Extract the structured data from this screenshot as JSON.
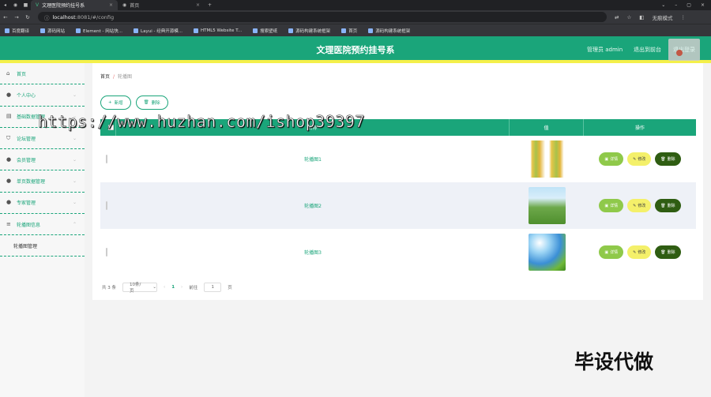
{
  "browser": {
    "tabs": [
      {
        "title": "文理医院预约挂号系",
        "active": true
      },
      {
        "title": "首页",
        "active": false
      }
    ],
    "url_host": "localhost",
    "url_rest": ":8081/#/config",
    "incognito_label": "无痕模式",
    "bookmarks": [
      "百度翻译",
      "源码网站",
      "Element - 网站快...",
      "Layui - 经典开源模...",
      "HTML5 Website T...",
      "搜索壁纸",
      "源码构建系统框架",
      "首页",
      "源码构建系统框架"
    ]
  },
  "header": {
    "title": "文理医院预约挂号系",
    "user": "管理员 admin",
    "exit_label": "退出到前台",
    "logout_label": "退出登录"
  },
  "sidebar": {
    "items": [
      {
        "label": "首页",
        "icon": "home-icon"
      },
      {
        "label": "个人中心",
        "icon": "user-icon"
      },
      {
        "label": "基础数据管理",
        "icon": "doc-icon"
      },
      {
        "label": "论坛管理",
        "icon": "shield-icon"
      },
      {
        "label": "会员管理",
        "icon": "user-icon"
      },
      {
        "label": "单页数据管理",
        "icon": "user-icon"
      },
      {
        "label": "专家管理",
        "icon": "user-icon"
      },
      {
        "label": "轮播图信息",
        "icon": "list-icon"
      }
    ],
    "submenu": "轮播图管理"
  },
  "breadcrumb": {
    "home": "首页",
    "sep": "/",
    "current": "轮播图"
  },
  "toolbar": {
    "add": "新增",
    "delete": "删除"
  },
  "table": {
    "columns": [
      "名称",
      "值",
      "操作"
    ],
    "rows": [
      {
        "name": "轮播图1",
        "image": "corn"
      },
      {
        "name": "轮播图2",
        "image": "field"
      },
      {
        "name": "轮播图3",
        "image": "sky"
      }
    ],
    "ops": {
      "detail": "详情",
      "edit": "修改",
      "delete": "删除"
    }
  },
  "pager": {
    "total": "共 3 条",
    "size": "10条/页",
    "page": "1",
    "goto_label": "前往",
    "goto_value": "1",
    "page_unit": "页"
  },
  "overlay": {
    "watermark": "https://www.huzhan.com/ishop39397",
    "stamp": "毕设代做"
  },
  "colors": {
    "primary": "#1aa57a",
    "accent": "#f4f04a",
    "dark_green": "#2f5d12",
    "light_green": "#8fc94a"
  }
}
